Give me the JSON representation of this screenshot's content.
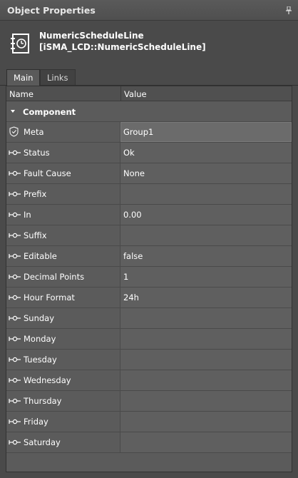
{
  "panel": {
    "title": "Object Properties"
  },
  "component": {
    "name": "NumericScheduleLine",
    "type": "[iSMA_LCD::NumericScheduleLine]"
  },
  "tabs": [
    {
      "label": "Main",
      "active": true
    },
    {
      "label": "Links",
      "active": false
    }
  ],
  "columns": {
    "name": "Name",
    "value": "Value"
  },
  "section": {
    "label": "Component"
  },
  "properties": [
    {
      "name": "Meta",
      "value": "Group1",
      "icon": "meta-shield-icon"
    },
    {
      "name": "Status",
      "value": "Ok",
      "icon": "slot-icon"
    },
    {
      "name": "Fault Cause",
      "value": "None",
      "icon": "slot-icon"
    },
    {
      "name": "Prefix",
      "value": "",
      "icon": "slot-icon"
    },
    {
      "name": "In",
      "value": "0.00",
      "icon": "slot-icon"
    },
    {
      "name": "Suffix",
      "value": "",
      "icon": "slot-icon"
    },
    {
      "name": "Editable",
      "value": "false",
      "icon": "slot-icon"
    },
    {
      "name": "Decimal Points",
      "value": "1",
      "icon": "slot-icon"
    },
    {
      "name": "Hour Format",
      "value": "24h",
      "icon": "slot-icon"
    },
    {
      "name": "Sunday",
      "value": "",
      "icon": "slot-icon"
    },
    {
      "name": "Monday",
      "value": "",
      "icon": "slot-icon"
    },
    {
      "name": "Tuesday",
      "value": "",
      "icon": "slot-icon"
    },
    {
      "name": "Wednesday",
      "value": "",
      "icon": "slot-icon"
    },
    {
      "name": "Thursday",
      "value": "",
      "icon": "slot-icon"
    },
    {
      "name": "Friday",
      "value": "",
      "icon": "slot-icon"
    },
    {
      "name": "Saturday",
      "value": "",
      "icon": "slot-icon"
    }
  ],
  "colors": {
    "panel_bg": "#4a4a4a",
    "grid_bg": "#5b5b5b",
    "text": "#ffffff"
  }
}
